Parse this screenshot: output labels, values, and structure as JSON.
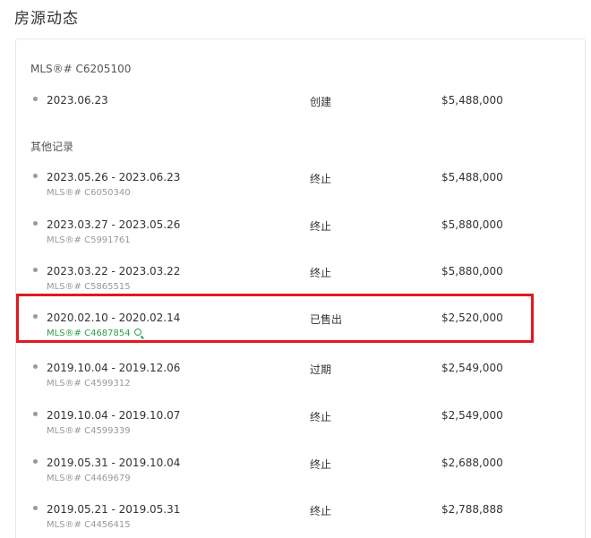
{
  "page": {
    "title": "房源动态"
  },
  "current": {
    "label": "MLS®# C6205100",
    "row": {
      "date": "2023.06.23",
      "status": "创建",
      "price": "$5,488,000"
    }
  },
  "other": {
    "label": "其他记录",
    "rows": [
      {
        "date": "2023.05.26 - 2023.06.23",
        "mls": "MLS®# C6050340",
        "status": "终止",
        "price": "$5,488,000"
      },
      {
        "date": "2023.03.27 - 2023.05.26",
        "mls": "MLS®# C5991761",
        "status": "终止",
        "price": "$5,880,000"
      },
      {
        "date": "2023.03.22 - 2023.03.22",
        "mls": "MLS®# C5865515",
        "status": "终止",
        "price": "$5,880,000"
      },
      {
        "date": "2020.02.10 - 2020.02.14",
        "mls": "MLS®# C4687854",
        "status": "已售出",
        "price": "$2,520,000",
        "highlighted": true
      },
      {
        "date": "2019.10.04 - 2019.12.06",
        "mls": "MLS®# C4599312",
        "status": "过期",
        "price": "$2,549,000"
      },
      {
        "date": "2019.10.04 - 2019.10.07",
        "mls": "MLS®# C4599339",
        "status": "终止",
        "price": "$2,549,000"
      },
      {
        "date": "2019.05.31 - 2019.10.04",
        "mls": "MLS®# C4469679",
        "status": "终止",
        "price": "$2,688,000"
      },
      {
        "date": "2019.05.21 - 2019.05.31",
        "mls": "MLS®# C4456415",
        "status": "终止",
        "price": "$2,788,888"
      }
    ]
  },
  "colors": {
    "highlight_border": "#e0191f",
    "mls_link": "#2e9e4f"
  }
}
